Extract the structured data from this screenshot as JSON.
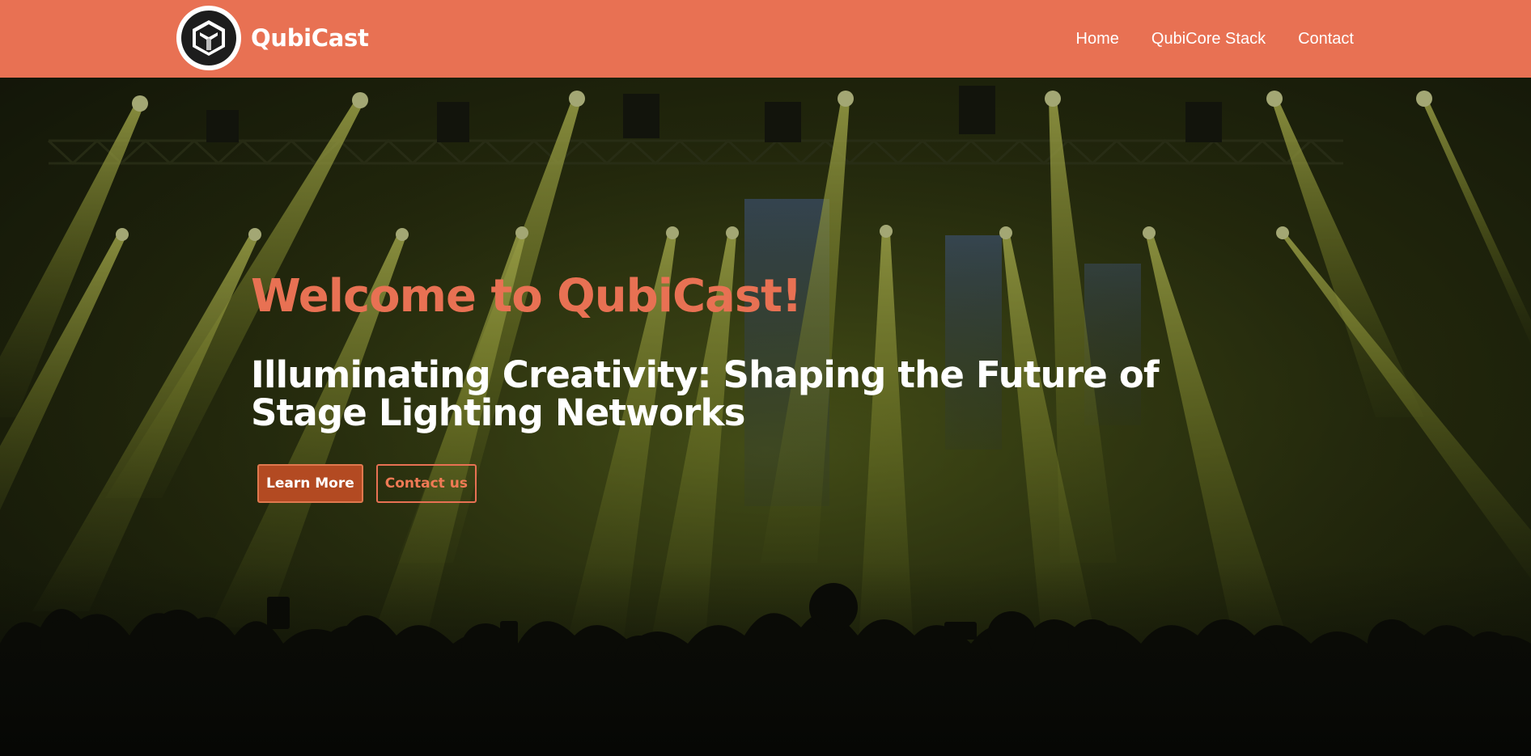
{
  "brand": {
    "name": "QubiCast",
    "logo_icon": "qubicast-cube-logo"
  },
  "nav": {
    "items": [
      {
        "label": "Home"
      },
      {
        "label": "QubiCore Stack"
      },
      {
        "label": "Contact"
      }
    ]
  },
  "hero": {
    "title": "Welcome to QubiCast!",
    "subtitle": "Illuminating Creativity: Shaping the Future of Stage Lighting Networks",
    "primary_button": "Learn More",
    "secondary_button": "Contact us",
    "background_image": "concert-stage-lights-crowd"
  },
  "colors": {
    "accent": "#e87153",
    "button_primary": "#b34a22",
    "text_light": "#ffffff"
  }
}
